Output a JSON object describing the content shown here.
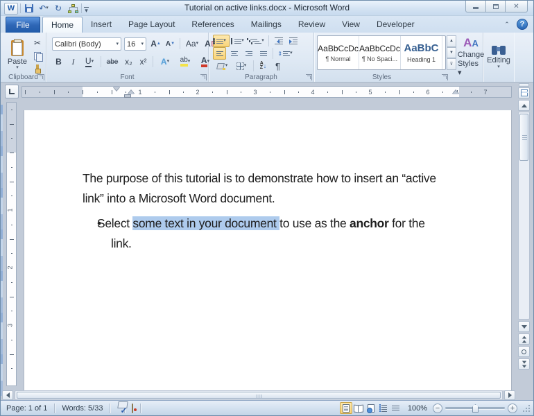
{
  "window": {
    "title": "Tutorial on active links.docx - Microsoft Word"
  },
  "qat": {
    "undo_glyph": "↶",
    "redo_glyph": "↻"
  },
  "tabs": {
    "file": "File",
    "items": [
      "Home",
      "Insert",
      "Page Layout",
      "References",
      "Mailings",
      "Review",
      "View",
      "Developer"
    ],
    "help_glyph": "?",
    "collapse_glyph": "▲"
  },
  "ribbon": {
    "clipboard": {
      "label": "Clipboard",
      "paste_label": "Paste",
      "cut_glyph": "✂"
    },
    "font": {
      "label": "Font",
      "name": "Calibri (Body)",
      "size": "16",
      "bold": "B",
      "italic": "I",
      "underline": "U",
      "strike": "abe",
      "subscript": "x₂",
      "superscript": "x²",
      "case_label": "Aa",
      "grow": "A",
      "shrink": "A",
      "effects": "A",
      "highlight": "ab",
      "color": "A",
      "clear": "A"
    },
    "paragraph": {
      "label": "Paragraph",
      "pilcrow": "¶",
      "sort_a": "A",
      "sort_z": "Z",
      "spacing_arrows": "⇕"
    },
    "styles": {
      "label": "Styles",
      "items": [
        {
          "preview": "AaBbCcDc",
          "name": "¶ Normal"
        },
        {
          "preview": "AaBbCcDc",
          "name": "¶ No Spaci..."
        },
        {
          "preview": "AaBbC",
          "name": "Heading 1"
        }
      ],
      "change_line1": "Change",
      "change_line2": "Styles ▾"
    },
    "editing": {
      "label": "Editing",
      "arrow": "▾"
    }
  },
  "ruler": {
    "h_numbers": [
      "1",
      "2",
      "3",
      "4",
      "5",
      "6",
      "7"
    ],
    "v_numbers": [
      "1",
      "2",
      "3"
    ]
  },
  "document": {
    "p1_line1": "The purpose of this tutorial is to demonstrate how to insert an “active",
    "p1_line2": "link” into a Microsoft Word document.",
    "bullet_glyph": "•",
    "b_pre": "Select ",
    "b_selected": "some text in your document ",
    "b_mid": "to use as the ",
    "b_bold": "anchor",
    "b_post": " for the",
    "b_line2": "link."
  },
  "statusbar": {
    "page": "Page: 1 of 1",
    "words": "Words: 5/33",
    "zoom_level": "100%"
  },
  "colors": {
    "selection": "#aecbed",
    "heading": "#365f91",
    "file_tab_blue": "#2f67b6",
    "active_toggle": "#f9d478"
  }
}
